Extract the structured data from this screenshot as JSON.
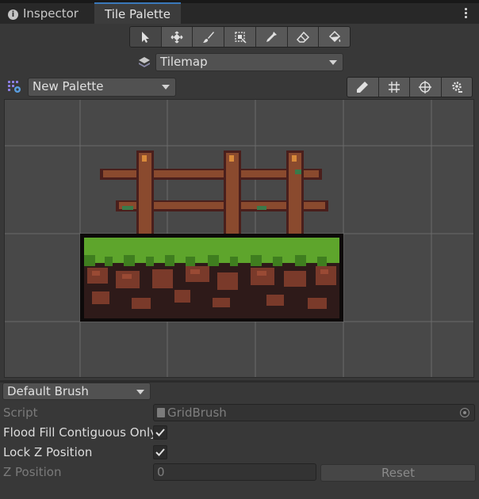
{
  "tabs": {
    "inspector": "Inspector",
    "tile_palette": "Tile Palette"
  },
  "toolbar": {
    "tools": [
      {
        "name": "select-tool",
        "icon": "arrow-cursor-icon",
        "active": true
      },
      {
        "name": "move-tool",
        "icon": "move-arrows-icon",
        "active": false
      },
      {
        "name": "paint-tool",
        "icon": "brush-icon",
        "active": false
      },
      {
        "name": "box-fill-tool",
        "icon": "box-fill-icon",
        "active": false
      },
      {
        "name": "picker-tool",
        "icon": "eyedropper-icon",
        "active": false
      },
      {
        "name": "erase-tool",
        "icon": "eraser-icon",
        "active": false
      },
      {
        "name": "fill-tool",
        "icon": "paint-bucket-icon",
        "active": false
      }
    ]
  },
  "active_tilemap": "Tilemap",
  "palette": {
    "selected": "New Palette",
    "view_tools": [
      "pencil-icon",
      "grid-icon",
      "gizmo-icon",
      "settings-icon"
    ]
  },
  "brush": {
    "selected": "Default Brush",
    "properties": {
      "script_label": "Script",
      "script_value": "GridBrush",
      "flood_fill_label": "Flood Fill Contiguous Only",
      "flood_fill_checked": true,
      "lock_z_label": "Lock Z Position",
      "lock_z_checked": true,
      "z_position_label": "Z Position",
      "z_position_value": "0",
      "reset_label": "Reset"
    }
  },
  "colors": {
    "accent": "#3a79bb",
    "panel": "#383838",
    "grass": "#5ea52c",
    "dirt": "#7a3a2a",
    "wood": "#8a4a2e"
  }
}
